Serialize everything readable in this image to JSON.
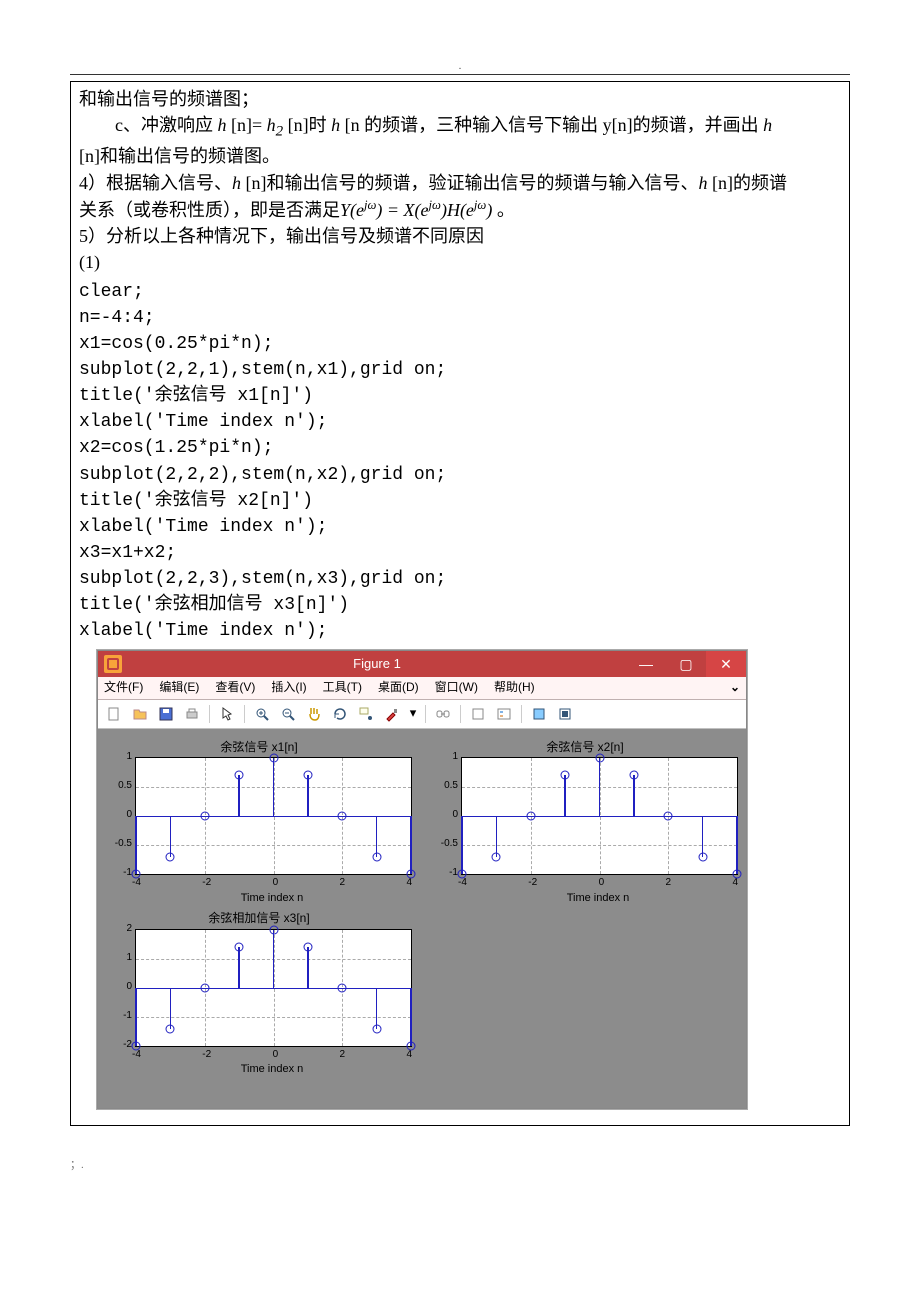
{
  "header_dot": ".",
  "text": {
    "line1": "和输出信号的频谱图；",
    "line2_pre": "c、冲激响应 ",
    "line2_h": "h",
    "line2_mid1": " [n]= ",
    "line2_h2": "h",
    "line2_sub2": "2",
    "line2_mid2": " [n]时 ",
    "line2_h3": "h",
    "line2_rest": " [n 的频谱，三种输入信号下输出 y[n]的频谱，并画出 ",
    "line2_h4": "h",
    "line3": " [n]和输出信号的频谱图。",
    "line4_pre": "4）根据输入信号、",
    "line4_h": "h",
    "line4_mid": " [n]和输出信号的频谱，验证输出信号的频谱与输入信号、",
    "line4_h2": "h",
    "line4_end": " [n]的频谱",
    "line5_pre": "关系（或卷积性质），即是否满足",
    "line5_formula": "Y(e^{jω}) = X(e^{jω})H(e^{jω})",
    "line5_end": " 。",
    "line6": "5）分析以上各种情况下，输出信号及频谱不同原因",
    "line7": "(1)"
  },
  "code": "clear;\nn=-4:4;\nx1=cos(0.25*pi*n);\nsubplot(2,2,1),stem(n,x1),grid on;\ntitle('余弦信号 x1[n]')\nxlabel('Time index n');\nx2=cos(1.25*pi*n);\nsubplot(2,2,2),stem(n,x2),grid on;\ntitle('余弦信号 x2[n]')\nxlabel('Time index n');\nx3=x1+x2;\nsubplot(2,2,3),stem(n,x3),grid on;\ntitle('余弦相加信号 x3[n]')\nxlabel('Time index n');",
  "figure": {
    "title": "Figure 1",
    "menu": [
      "文件(F)",
      "编辑(E)",
      "查看(V)",
      "插入(I)",
      "工具(T)",
      "桌面(D)",
      "窗口(W)",
      "帮助(H)"
    ],
    "more": "⌄"
  },
  "chart_data": [
    {
      "type": "stem",
      "title": "余弦信号 x1[n]",
      "xlabel": "Time index n",
      "x": [
        -4,
        -3,
        -2,
        -1,
        0,
        1,
        2,
        3,
        4
      ],
      "y": [
        -1,
        -0.707,
        0,
        0.707,
        1,
        0.707,
        0,
        -0.707,
        -1
      ],
      "ylim": [
        -1,
        1
      ],
      "yticks": [
        -1,
        -0.5,
        0,
        0.5,
        1
      ],
      "xlim": [
        -4,
        4
      ],
      "xticks": [
        -4,
        -2,
        0,
        2,
        4
      ]
    },
    {
      "type": "stem",
      "title": "余弦信号 x2[n]",
      "xlabel": "Time index n",
      "x": [
        -4,
        -3,
        -2,
        -1,
        0,
        1,
        2,
        3,
        4
      ],
      "y": [
        -1,
        -0.707,
        0,
        0.707,
        1,
        0.707,
        0,
        -0.707,
        -1
      ],
      "ylim": [
        -1,
        1
      ],
      "yticks": [
        -1,
        -0.5,
        0,
        0.5,
        1
      ],
      "xlim": [
        -4,
        4
      ],
      "xticks": [
        -4,
        -2,
        0,
        2,
        4
      ]
    },
    {
      "type": "stem",
      "title": "余弦相加信号 x3[n]",
      "xlabel": "Time index n",
      "x": [
        -4,
        -3,
        -2,
        -1,
        0,
        1,
        2,
        3,
        4
      ],
      "y": [
        -2,
        -1.414,
        0,
        1.414,
        2,
        1.414,
        0,
        -1.414,
        -2
      ],
      "ylim": [
        -2,
        2
      ],
      "yticks": [
        -2,
        -1,
        0,
        1,
        2
      ],
      "xlim": [
        -4,
        4
      ],
      "xticks": [
        -4,
        -2,
        0,
        2,
        4
      ]
    }
  ],
  "footer": "；."
}
